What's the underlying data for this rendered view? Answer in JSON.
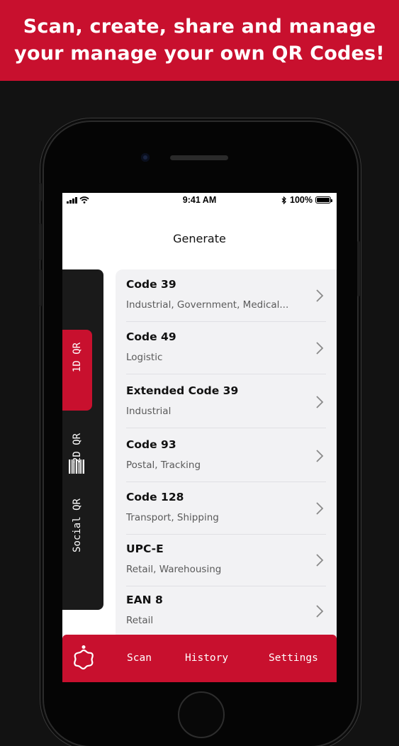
{
  "banner": {
    "line1": "Scan, create, share and manage",
    "line2": "your manage your own QR Codes!"
  },
  "status_bar": {
    "time": "9:41 AM",
    "battery": "100%"
  },
  "screen_title": "Generate",
  "side_tabs": [
    {
      "label": "1D QR",
      "active": true
    },
    {
      "label": "2D QR",
      "active": false
    },
    {
      "label": "Social QR",
      "active": false
    }
  ],
  "barcodes": [
    {
      "name": "Code 39",
      "description": "Industrial, Government, Medical..."
    },
    {
      "name": "Code 49",
      "description": "Logistic"
    },
    {
      "name": "Extended Code 39",
      "description": "Industrial"
    },
    {
      "name": "Code 93",
      "description": "Postal, Tracking"
    },
    {
      "name": "Code 128",
      "description": "Transport, Shipping"
    },
    {
      "name": "UPC-E",
      "description": "Retail, Warehousing"
    },
    {
      "name": "EAN 8",
      "description": "Retail"
    }
  ],
  "tab_bar": {
    "scan": "Scan",
    "history": "History",
    "settings": "Settings"
  },
  "colors": {
    "brand_red": "#c8102e",
    "dark": "#1a1a1a"
  }
}
